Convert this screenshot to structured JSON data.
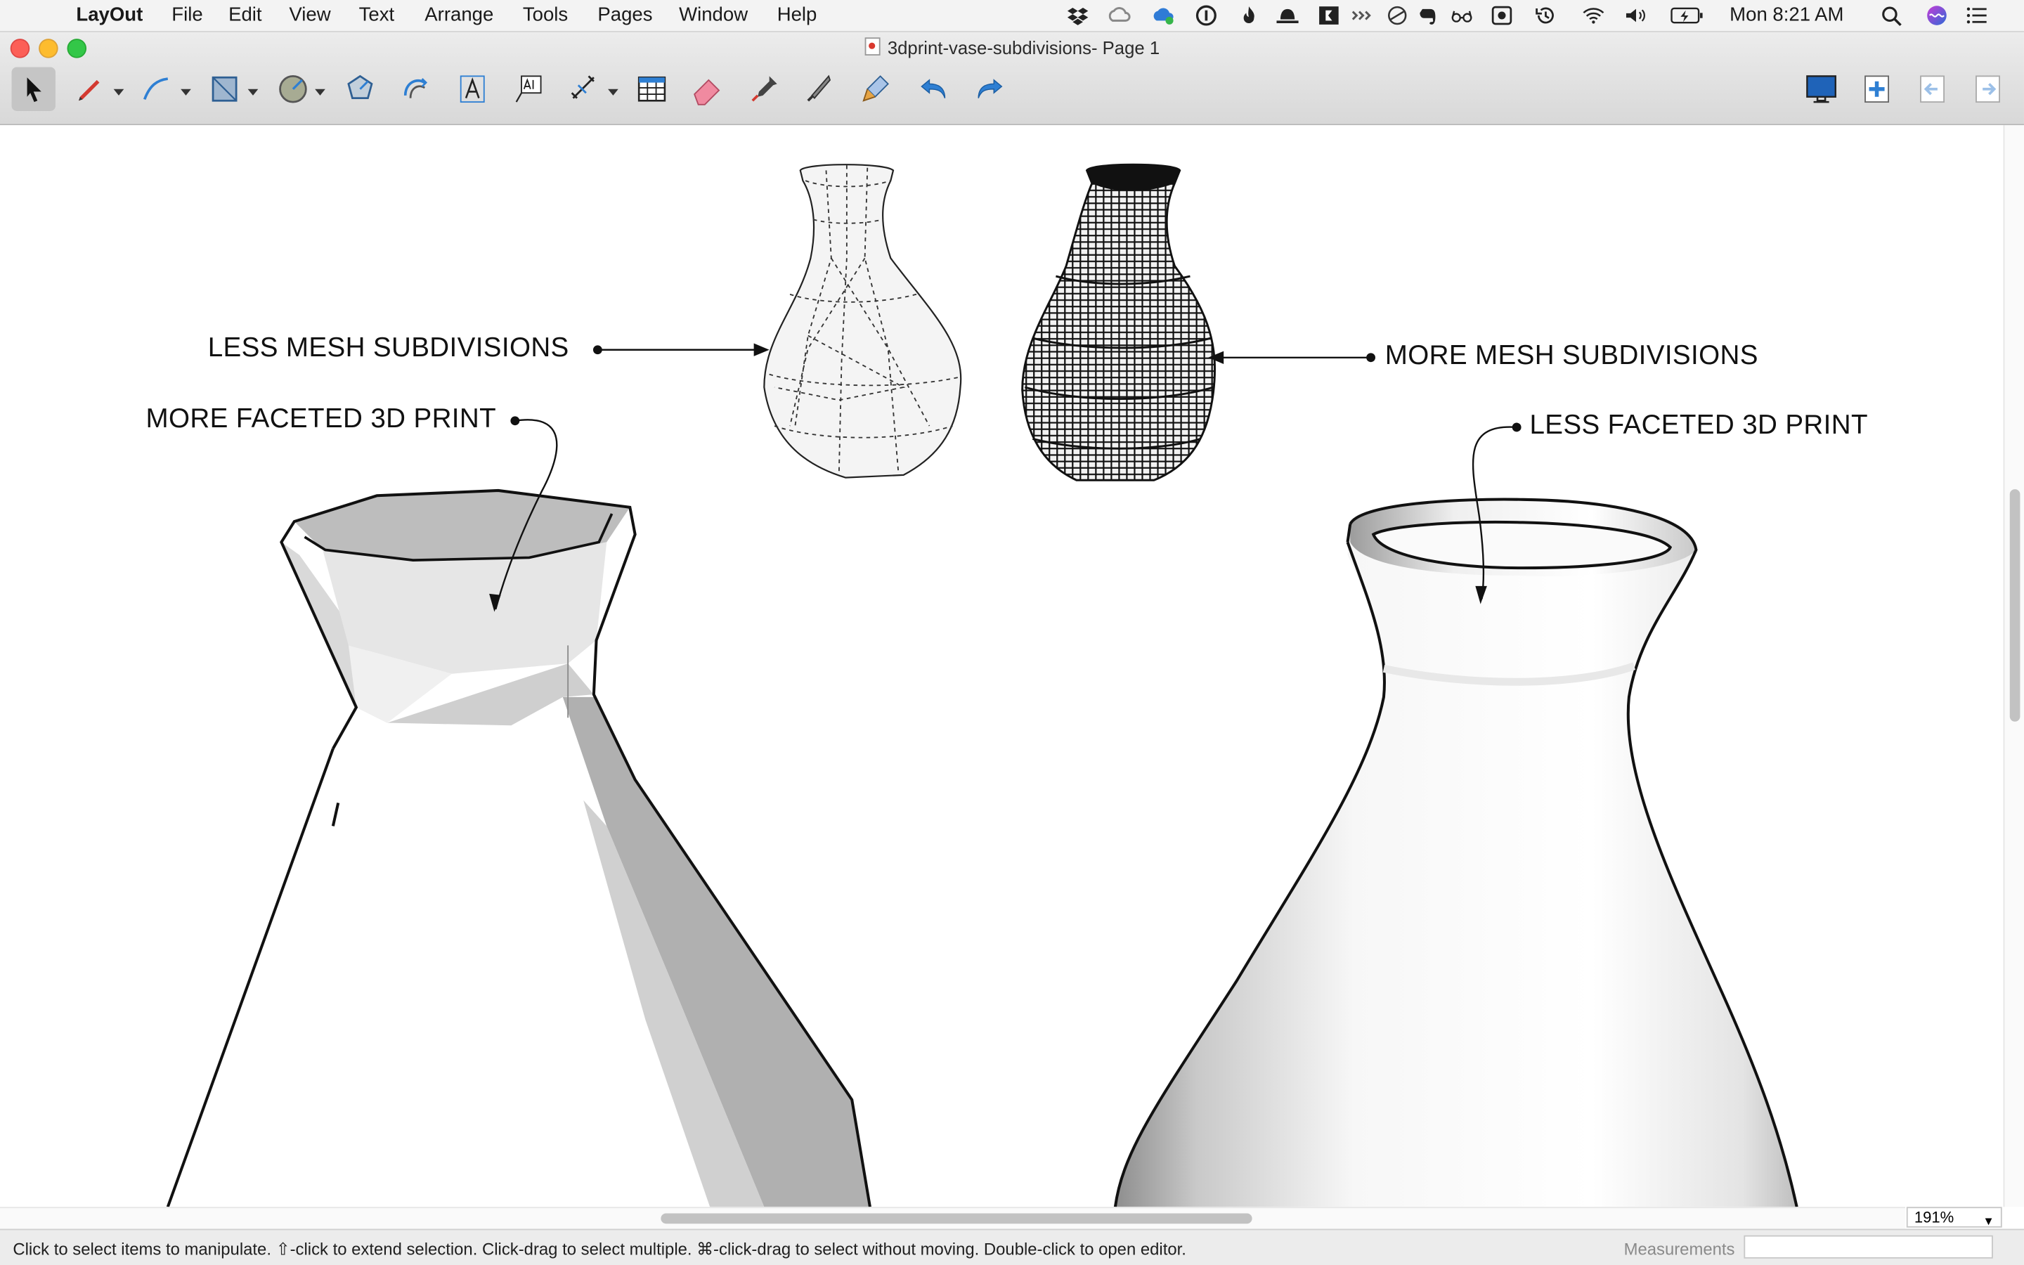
{
  "menubar": {
    "app_name": "LayOut",
    "items": [
      "File",
      "Edit",
      "View",
      "Text",
      "Arrange",
      "Tools",
      "Pages",
      "Window",
      "Help"
    ],
    "clock": "Mon 8:21 AM",
    "status_icons": [
      "dropbox-icon",
      "creative-cloud-icon",
      "onedrive-icon",
      "onepassword-icon",
      "flame-icon",
      "hat-icon",
      "cinemagraph-icon",
      "link-icon",
      "circle-slash-icon",
      "evernote-icon",
      "glasses-icon",
      "record-icon",
      "time-machine-icon",
      "wifi-icon",
      "volume-icon",
      "battery-icon",
      "spotlight-icon",
      "siri-icon",
      "notification-center-icon"
    ]
  },
  "window": {
    "title": "3dprint-vase-subdivisions- Page 1"
  },
  "toolbar": {
    "tools": [
      "select-tool",
      "line-tool",
      "arc-tool",
      "rectangle-tool",
      "circle-tool",
      "polygon-tool",
      "offset-tool",
      "text-tool",
      "label-tool",
      "dimension-tool",
      "table-tool",
      "eraser-tool",
      "style-tool",
      "split-tool",
      "join-tool",
      "undo",
      "redo"
    ],
    "right_tools": [
      "present-button",
      "add-page-button",
      "previous-page-button",
      "next-page-button"
    ]
  },
  "canvas": {
    "labels": {
      "less_mesh": "LESS MESH SUBDIVISIONS",
      "more_mesh": "MORE MESH SUBDIVISIONS",
      "more_faceted": "MORE FACETED 3D PRINT",
      "less_faceted": "LESS FACETED 3D PRINT"
    }
  },
  "zoom": {
    "value": "191%"
  },
  "statusbar": {
    "hint": "Click to select items to manipulate. ⇧-click to extend selection. Click-drag to select multiple. ⌘-click-drag to select without moving. Double-click to open editor.",
    "measurements_label": "Measurements",
    "measurements_value": ""
  },
  "colors": {
    "accent": "#2e7fd3",
    "close": "#fc5f57",
    "minimize": "#fdbc2e",
    "maximize": "#33c748"
  }
}
